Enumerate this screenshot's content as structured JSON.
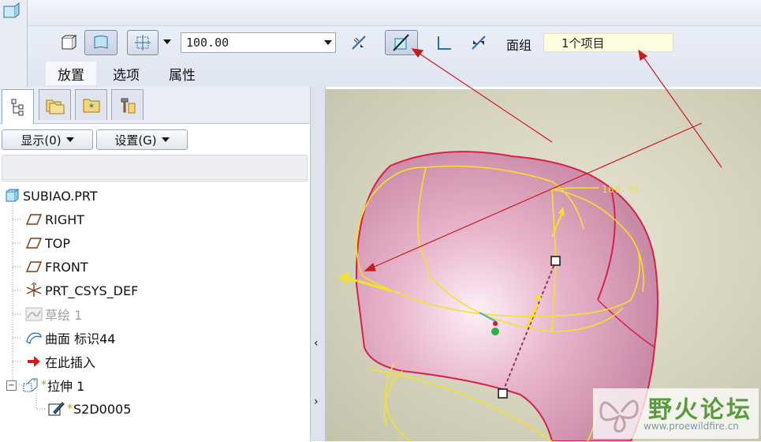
{
  "ribbon": {
    "depth_value": "100.00",
    "quilt_label": "面组",
    "quilt_value": "1个项目",
    "tabs": [
      {
        "label": "放置"
      },
      {
        "label": "选项"
      },
      {
        "label": "属性"
      }
    ]
  },
  "navigator": {
    "show_button": "显示(0)",
    "settings_button": "设置(G)"
  },
  "tree": {
    "items": [
      {
        "label": "SUBIAO.PRT",
        "icon": "part-icon"
      },
      {
        "label": "RIGHT",
        "icon": "datum-plane-icon"
      },
      {
        "label": "TOP",
        "icon": "datum-plane-icon"
      },
      {
        "label": "FRONT",
        "icon": "datum-plane-icon"
      },
      {
        "label": "PRT_CSYS_DEF",
        "icon": "csys-icon"
      },
      {
        "label": "草绘 1",
        "icon": "sketch-icon"
      },
      {
        "label": "曲面 标识44",
        "icon": "surface-icon"
      },
      {
        "label": "在此插入",
        "icon": "insert-here-arrow-icon"
      },
      {
        "label": "拉伸 1",
        "icon": "extrude-icon"
      },
      {
        "label": "S2D0005",
        "icon": "section-sketch-icon"
      }
    ]
  },
  "viewport": {
    "dimension_label": "100.00"
  },
  "watermark": {
    "title": "野火论坛",
    "url": "www.proewildfire.cn"
  },
  "colors": {
    "surface_pink": "#e7a9c5",
    "edge_red": "#d8204a",
    "preview_yellow": "#f2e32a",
    "annotation_arrow": "#cc1a1a"
  }
}
